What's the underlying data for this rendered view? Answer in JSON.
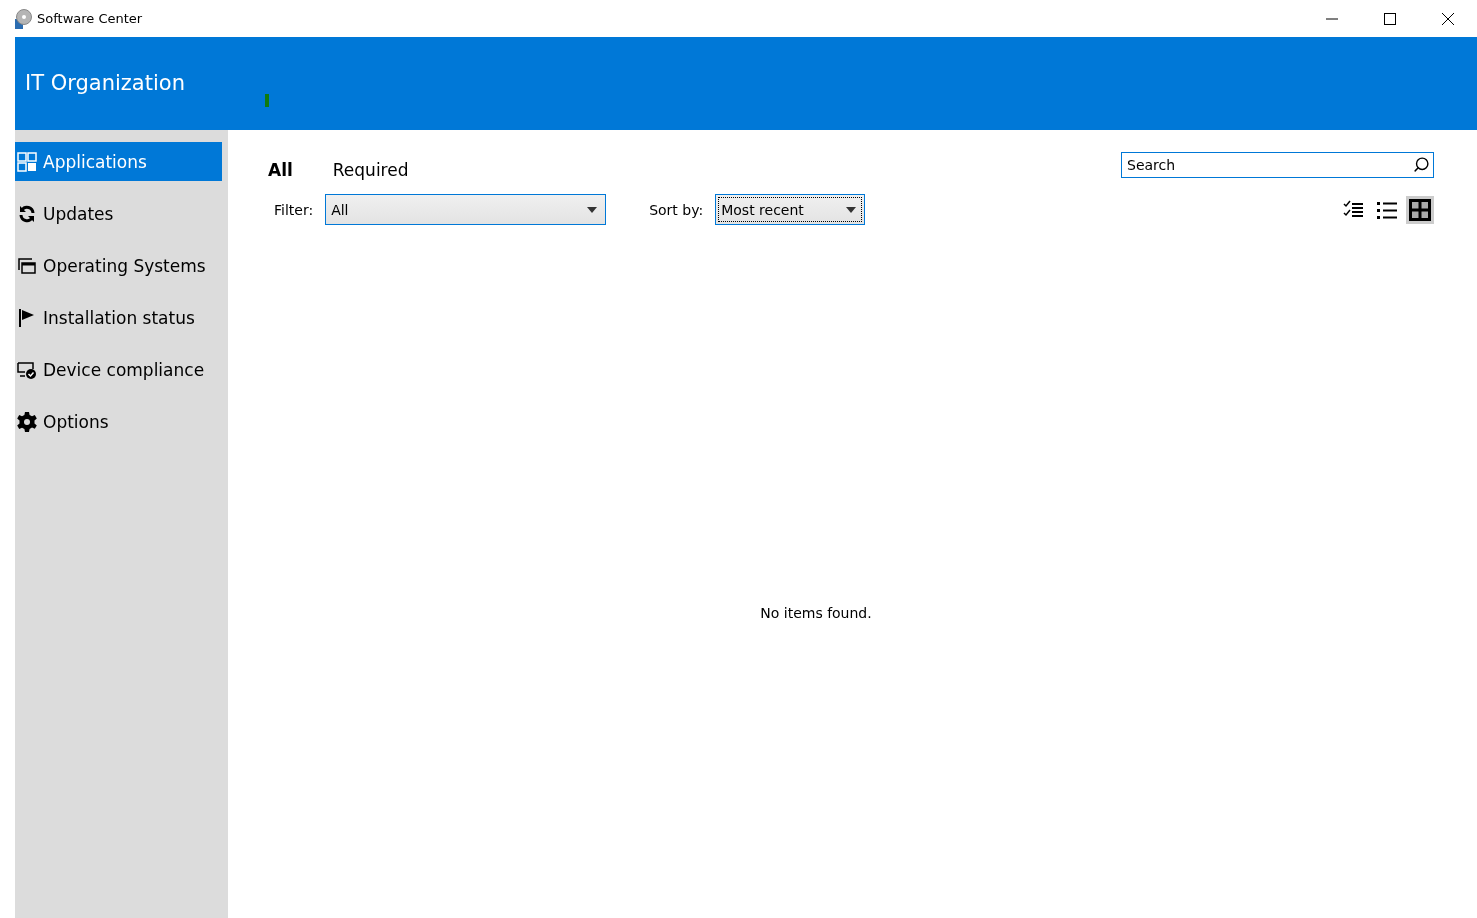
{
  "window": {
    "title": "Software Center"
  },
  "header": {
    "title": "IT Organization"
  },
  "sidebar": {
    "items": [
      {
        "label": "Applications",
        "kind": "apps",
        "selected": true
      },
      {
        "label": "Updates",
        "kind": "updates",
        "selected": false
      },
      {
        "label": "Operating Systems",
        "kind": "os",
        "selected": false
      },
      {
        "label": "Installation status",
        "kind": "status",
        "selected": false
      },
      {
        "label": "Device compliance",
        "kind": "compliance",
        "selected": false
      },
      {
        "label": "Options",
        "kind": "options",
        "selected": false
      }
    ]
  },
  "tabs": [
    {
      "label": "All",
      "selected": true
    },
    {
      "label": "Required",
      "selected": false
    }
  ],
  "search": {
    "placeholder": "Search"
  },
  "filter": {
    "label": "Filter:",
    "value": "All"
  },
  "sort": {
    "label": "Sort by:",
    "value": "Most recent",
    "focused": true
  },
  "view_buttons": [
    {
      "kind": "checklist",
      "selected": false
    },
    {
      "kind": "list",
      "selected": false
    },
    {
      "kind": "tiles",
      "selected": true
    }
  ],
  "empty_message": "No items found."
}
